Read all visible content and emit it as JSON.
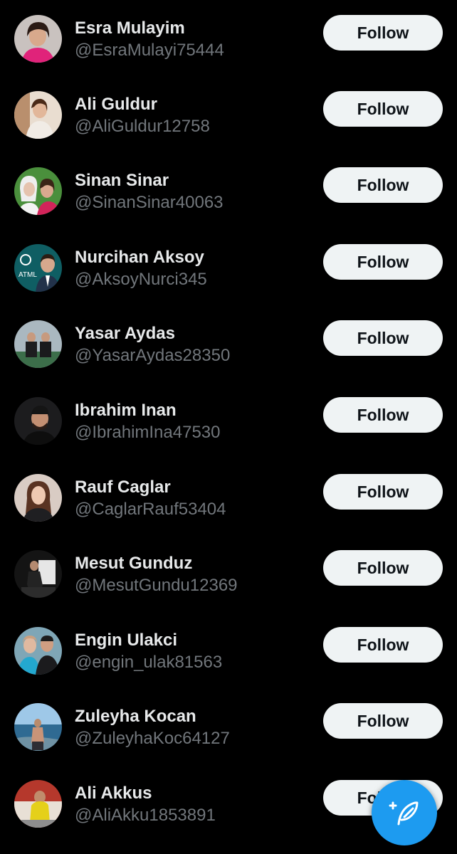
{
  "colors": {
    "background": "#000000",
    "name_text": "#e7e9ea",
    "handle_text": "#71767b",
    "button_bg": "#eff3f4",
    "fab_bg": "#1d9bf0"
  },
  "users": [
    {
      "name": "Esra Mulayim",
      "handle": "@EsraMulayi75444",
      "follow_label": "Follow"
    },
    {
      "name": "Ali Guldur",
      "handle": "@AliGuldur12758",
      "follow_label": "Follow"
    },
    {
      "name": "Sinan Sinar",
      "handle": "@SinanSinar40063",
      "follow_label": "Follow"
    },
    {
      "name": "Nurcihan Aksoy",
      "handle": "@AksoyNurci345",
      "follow_label": "Follow"
    },
    {
      "name": "Yasar Aydas",
      "handle": "@YasarAydas28350",
      "follow_label": "Follow"
    },
    {
      "name": "Ibrahim Inan",
      "handle": "@IbrahimIna47530",
      "follow_label": "Follow"
    },
    {
      "name": "Rauf Caglar",
      "handle": "@CaglarRauf53404",
      "follow_label": "Follow"
    },
    {
      "name": "Mesut Gunduz",
      "handle": "@MesutGundu12369",
      "follow_label": "Follow"
    },
    {
      "name": "Engin Ulakci",
      "handle": "@engin_ulak81563",
      "follow_label": "Follow"
    },
    {
      "name": "Zuleyha Kocan",
      "handle": "@ZuleyhaKoc64127",
      "follow_label": "Follow"
    },
    {
      "name": "Ali Akkus",
      "handle": "@AliAkku1853891",
      "follow_label": "Follow"
    }
  ],
  "fab": {
    "icon": "compose-post-icon"
  }
}
